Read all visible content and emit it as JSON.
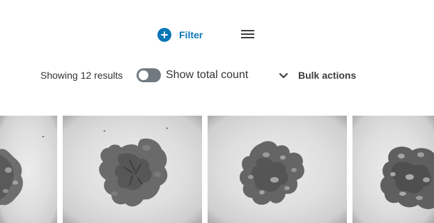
{
  "toolbar": {
    "filter_label": "Filter",
    "filter_icon": "plus-circle-icon",
    "menu_icon": "hamburger-menu-icon",
    "accent_color": "#0a76b8"
  },
  "results": {
    "summary": "Showing 12 results",
    "toggle_label": "Show total count",
    "toggle_on": false,
    "bulk_actions_label": "Bulk actions",
    "bulk_icon": "chevron-down-icon"
  },
  "gallery": {
    "items": [
      {
        "subject": "walnut kernel"
      },
      {
        "subject": "walnut kernel"
      },
      {
        "subject": "walnut kernel"
      },
      {
        "subject": "walnut kernel"
      }
    ]
  }
}
